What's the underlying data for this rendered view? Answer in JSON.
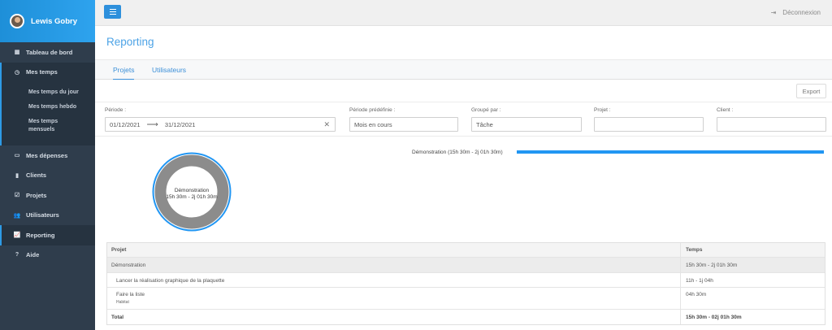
{
  "user": {
    "name": "Lewis Gobry"
  },
  "sidebar": {
    "items": [
      {
        "label": "Tableau de bord",
        "icon": "dashboard-icon"
      },
      {
        "label": "Mes temps",
        "icon": "clock-icon"
      },
      {
        "label": "Mes dépenses",
        "icon": "money-icon"
      },
      {
        "label": "Clients",
        "icon": "building-icon"
      },
      {
        "label": "Projets",
        "icon": "checklist-icon"
      },
      {
        "label": "Utilisateurs",
        "icon": "users-icon"
      },
      {
        "label": "Reporting",
        "icon": "chart-icon"
      },
      {
        "label": "Aide",
        "icon": "question-icon"
      }
    ],
    "submenu": [
      "Mes temps du jour",
      "Mes temps hebdo",
      "Mes temps mensuels"
    ]
  },
  "topbar": {
    "logout_label": "Déconnexion"
  },
  "page": {
    "title": "Reporting"
  },
  "tabs": [
    "Projets",
    "Utilisateurs"
  ],
  "export_label": "Export",
  "filters": {
    "periode_label": "Période :",
    "periode_start": "01/12/2021",
    "periode_end": "31/12/2021",
    "predef_label": "Période prédéfinie :",
    "predef_value": "Mois en cours",
    "group_label": "Groupé par :",
    "group_value": "Tâche",
    "projet_label": "Projet :",
    "client_label": "Client :"
  },
  "chart_data": {
    "type": "pie",
    "categories": [
      "Démonstration"
    ],
    "values": [
      1
    ],
    "slice_labels": [
      "Démonstration",
      "15h 30m - 2j 01h 30m"
    ],
    "bar_label": "Démonstration (15h 30m - 2j 01h 30m)",
    "colors": {
      "ring": "#8c8c8c",
      "outline": "#2196f3",
      "bar": "#2196f3"
    }
  },
  "table": {
    "headers": [
      "Projet",
      "Temps"
    ],
    "group": {
      "name": "Démonstration",
      "time": "15h 30m - 2j 01h 30m"
    },
    "tasks": [
      {
        "name": "Lancer la réalisation graphique de la plaquette",
        "time": "11h - 1j 04h",
        "tag": ""
      },
      {
        "name": "Faire la liste",
        "time": "04h 30m",
        "tag": "Habitat"
      }
    ],
    "total": {
      "label": "Total",
      "time": "15h 30m - 02j 01h 30m"
    }
  },
  "colors": {
    "accent": "#2e90dc",
    "sidebar": "#2f3d4c"
  }
}
